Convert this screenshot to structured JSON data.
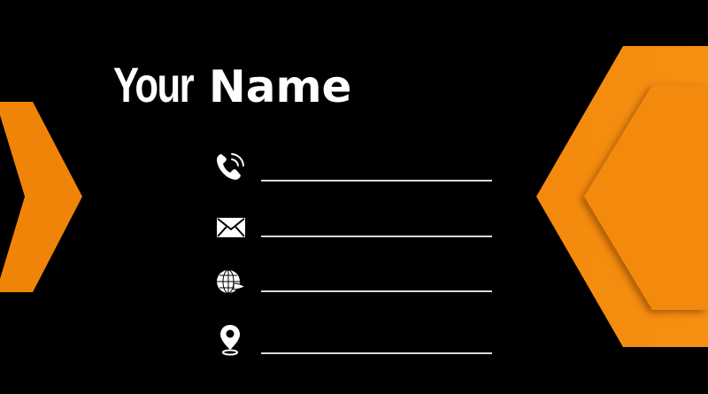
{
  "card": {
    "name_first": "Your",
    "name_last": "Name",
    "colors": {
      "background": "#000000",
      "accent_orange": "#f5870d",
      "accent_orange_light": "#f79214",
      "accent_orange_shadow": "#d86c05",
      "text": "#ffffff",
      "line": "#d9d9d9"
    },
    "contacts": [
      {
        "icon": "phone-icon",
        "value": ""
      },
      {
        "icon": "email-icon",
        "value": ""
      },
      {
        "icon": "globe-icon",
        "value": ""
      },
      {
        "icon": "location-pin-icon",
        "value": ""
      }
    ]
  }
}
